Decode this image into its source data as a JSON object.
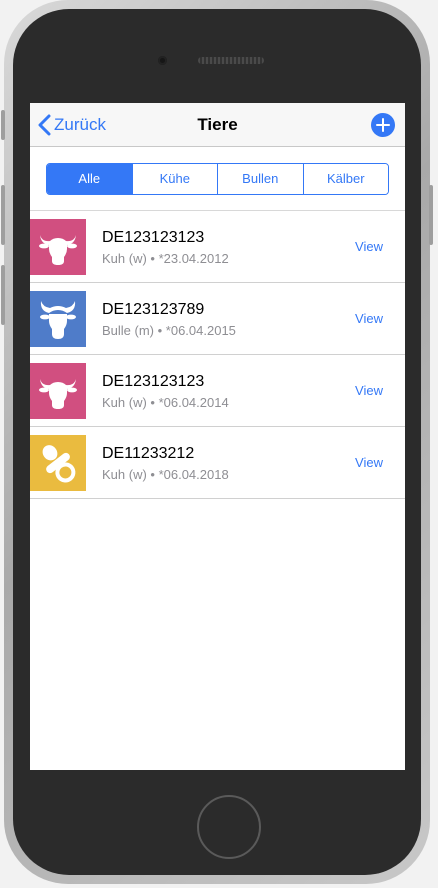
{
  "navbar": {
    "back_label": "Zurück",
    "title": "Tiere"
  },
  "filter": {
    "segments": [
      "Alle",
      "Kühe",
      "Bullen",
      "Kälber"
    ],
    "selected": "Alle"
  },
  "animals": [
    {
      "id": "DE123123123",
      "detail": "Kuh (w) • *23.04.2012",
      "action": "View",
      "icon": "cow-icon",
      "color": "#d14f80"
    },
    {
      "id": "DE123123789",
      "detail": "Bulle (m) • *06.04.2015",
      "action": "View",
      "icon": "bull-icon",
      "color": "#4f7cc9"
    },
    {
      "id": "DE123123123",
      "detail": "Kuh (w) • *06.04.2014",
      "action": "View",
      "icon": "cow-icon",
      "color": "#d14f80"
    },
    {
      "id": "DE11233212",
      "detail": "Kuh (w) • *06.04.2018",
      "action": "View",
      "icon": "pacifier-icon",
      "color": "#eabb3f"
    }
  ],
  "colors": {
    "accent": "#3478f6"
  }
}
